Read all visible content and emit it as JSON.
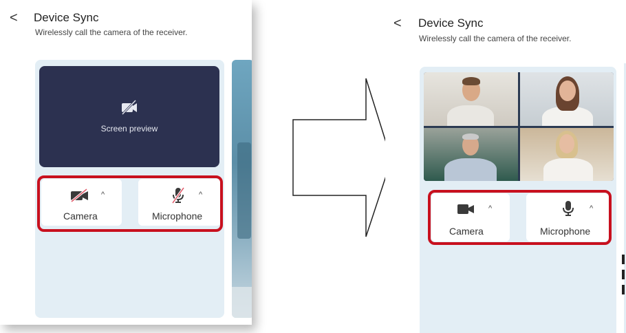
{
  "before": {
    "header": {
      "back_glyph": "<",
      "title": "Device Sync",
      "subtitle": "Wirelessly call the camera of the receiver."
    },
    "preview": {
      "label": "Screen preview"
    },
    "controls": {
      "camera": {
        "label": "Camera",
        "state": "off"
      },
      "microphone": {
        "label": "Microphone",
        "state": "off"
      }
    }
  },
  "after": {
    "header": {
      "back_glyph": "<",
      "title": "Device Sync",
      "subtitle": "Wirelessly call the camera of the receiver."
    },
    "controls": {
      "camera": {
        "label": "Camera",
        "state": "on"
      },
      "microphone": {
        "label": "Microphone",
        "state": "on"
      }
    }
  },
  "colors": {
    "highlight": "#c8101e",
    "card_background": "#e3eef5",
    "preview_background": "#2c3150",
    "disabled_slash": "#e05a6a"
  }
}
